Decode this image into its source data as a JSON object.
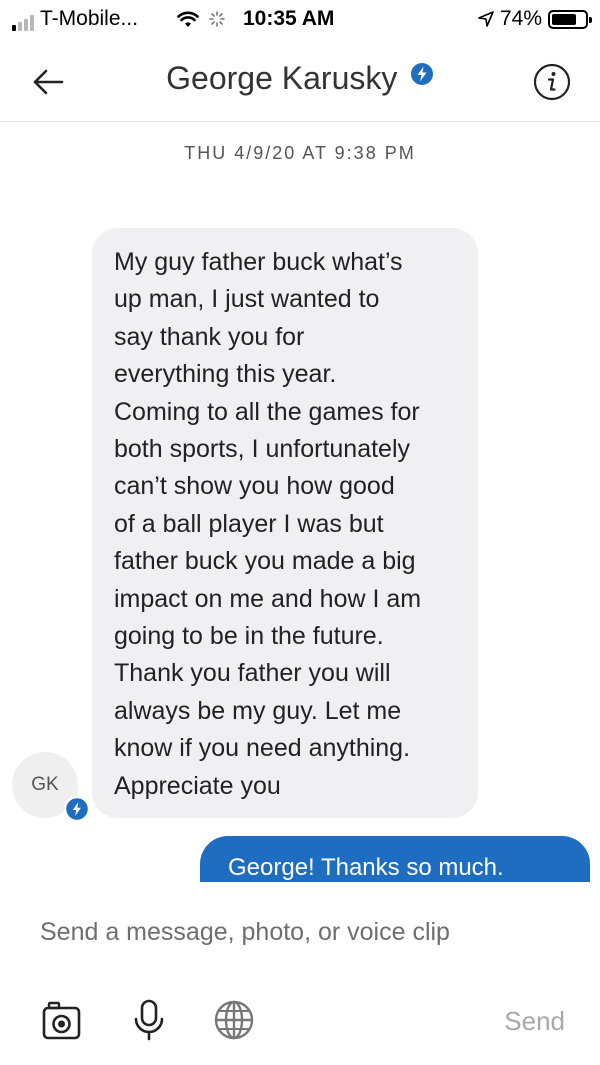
{
  "status_bar": {
    "carrier": "T-Mobile...",
    "time": "10:35 AM",
    "battery": "74%",
    "battery_level": 0.74
  },
  "header": {
    "title": "George Karusky"
  },
  "thread": {
    "timestamp": "THU 4/9/20 AT 9:38 PM",
    "incoming": {
      "avatar_initials": "GK",
      "text": "My guy father buck what’s\nup man, I just wanted to\nsay thank you for\neverything this year.\nComing to all the games for\nboth sports, I unfortunately\ncan’t show you how good\nof a ball player I was but\nfather buck you made a big\nimpact on me and how I am\ngoing to be in the future.\nThank you father you will\nalways be my guy. Let me\nknow if you need anything.\nAppreciate you"
    },
    "outgoing": {
      "text": "George!  Thanks so much."
    }
  },
  "compose": {
    "placeholder": "Send a message, photo, or voice clip",
    "send_label": "Send"
  },
  "colors": {
    "accent": "#1f6dc0",
    "incoming_bubble": "#f0f0f2",
    "muted_text": "#a8a8a8"
  }
}
